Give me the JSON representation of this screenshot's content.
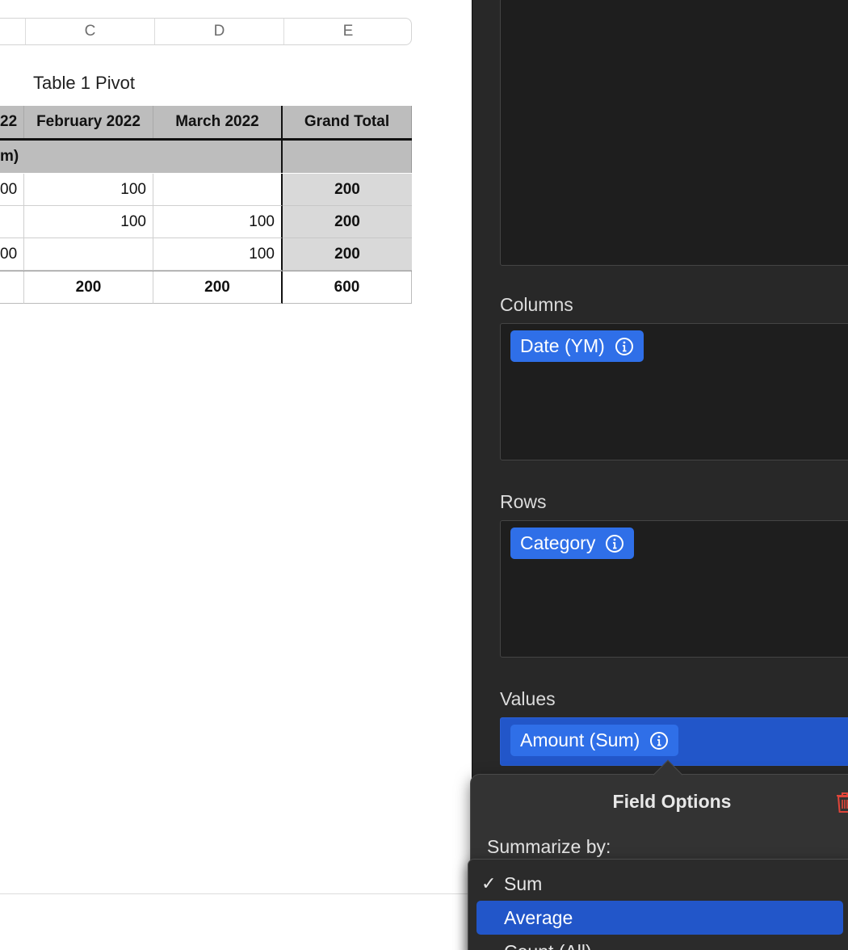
{
  "sheet": {
    "column_letters": [
      "C",
      "D",
      "E"
    ],
    "table_title": "Table 1 Pivot",
    "headers": [
      "22",
      "February 2022",
      "March 2022",
      "Grand Total"
    ],
    "group_label": "m)",
    "rows": [
      [
        "00",
        "100",
        "",
        "200"
      ],
      [
        "",
        "100",
        "100",
        "200"
      ],
      [
        "00",
        "",
        "100",
        "200"
      ]
    ],
    "totals": [
      "",
      "200",
      "200",
      "600"
    ]
  },
  "sidebar": {
    "columns_label": "Columns",
    "columns_chip": "Date (YM)",
    "rows_label": "Rows",
    "rows_chip": "Category",
    "values_label": "Values",
    "values_chip": "Amount (Sum)"
  },
  "popover": {
    "title": "Field Options",
    "summarize_label": "Summarize by:"
  },
  "menu": {
    "items": [
      {
        "label": "Sum",
        "checked": "✓"
      },
      {
        "label": "Average"
      },
      {
        "label": "Count (All)"
      }
    ]
  },
  "colors": {
    "accent": "#2f6fe8",
    "selection": "#2256c9",
    "sidebar_bg": "#282828",
    "delete": "#e0453a"
  }
}
